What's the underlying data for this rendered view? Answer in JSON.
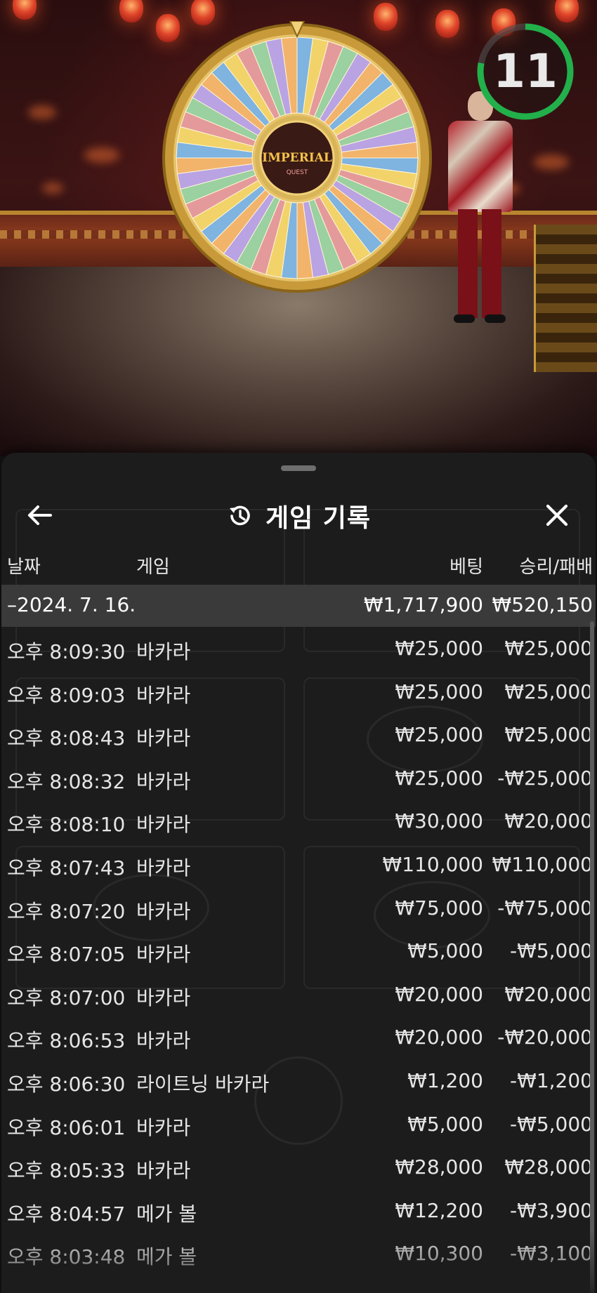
{
  "stream": {
    "wheel_logo": "IMPERIAL",
    "wheel_logo_sub": "QUEST",
    "countdown": "11",
    "countdown_progress": 0.78,
    "countdown_color": "#22b04b"
  },
  "history": {
    "title": "게임 기록",
    "icons": {
      "back": "arrow-left-icon",
      "history": "history-clock-icon",
      "close": "close-x-icon"
    },
    "columns": {
      "date": "날짜",
      "game": "게임",
      "bet": "베팅",
      "win": "승리/패배"
    },
    "summary": {
      "date": "–2024. 7. 16.",
      "bet": "₩1,717,900",
      "win": "₩520,150"
    },
    "rows": [
      {
        "time": "오후 8:09:30",
        "game": "바카라",
        "bet": "₩25,000",
        "win": "₩25,000"
      },
      {
        "time": "오후 8:09:03",
        "game": "바카라",
        "bet": "₩25,000",
        "win": "₩25,000"
      },
      {
        "time": "오후 8:08:43",
        "game": "바카라",
        "bet": "₩25,000",
        "win": "₩25,000"
      },
      {
        "time": "오후 8:08:32",
        "game": "바카라",
        "bet": "₩25,000",
        "win": "-₩25,000"
      },
      {
        "time": "오후 8:08:10",
        "game": "바카라",
        "bet": "₩30,000",
        "win": "₩20,000"
      },
      {
        "time": "오후 8:07:43",
        "game": "바카라",
        "bet": "₩110,000",
        "win": "₩110,000"
      },
      {
        "time": "오후 8:07:20",
        "game": "바카라",
        "bet": "₩75,000",
        "win": "-₩75,000"
      },
      {
        "time": "오후 8:07:05",
        "game": "바카라",
        "bet": "₩5,000",
        "win": "-₩5,000"
      },
      {
        "time": "오후 8:07:00",
        "game": "바카라",
        "bet": "₩20,000",
        "win": "₩20,000"
      },
      {
        "time": "오후 8:06:53",
        "game": "바카라",
        "bet": "₩20,000",
        "win": "-₩20,000"
      },
      {
        "time": "오후 8:06:30",
        "game": "라이트닝 바카라",
        "bet": "₩1,200",
        "win": "-₩1,200"
      },
      {
        "time": "오후 8:06:01",
        "game": "바카라",
        "bet": "₩5,000",
        "win": "-₩5,000"
      },
      {
        "time": "오후 8:05:33",
        "game": "바카라",
        "bet": "₩28,000",
        "win": "₩28,000"
      },
      {
        "time": "오후 8:04:57",
        "game": "메가 볼",
        "bet": "₩12,200",
        "win": "-₩3,900"
      },
      {
        "time": "오후 8:03:48",
        "game": "메가 볼",
        "bet": "₩10,300",
        "win": "-₩3,100"
      }
    ]
  }
}
